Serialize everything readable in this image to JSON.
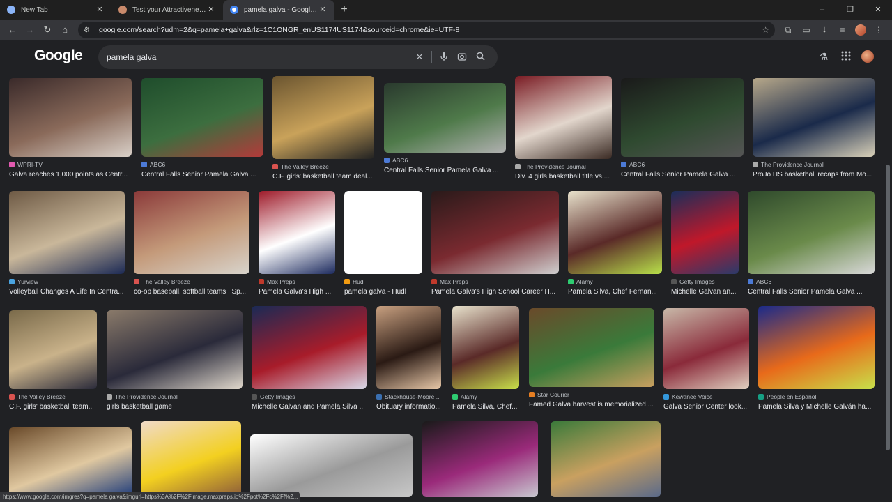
{
  "tabs": [
    {
      "title": "New Tab",
      "active": false,
      "favicon_color": "#8ab4f8"
    },
    {
      "title": "Test your Attractiveness with AI",
      "active": false,
      "favicon_color": "#c98a6b"
    },
    {
      "title": "pamela galva - Google Search",
      "active": true,
      "favicon_color": "#4285f4"
    }
  ],
  "window": {
    "minimize": "–",
    "restore": "❐",
    "close": "✕",
    "new_tab": "+"
  },
  "toolbar": {
    "url": "google.com/search?udm=2&q=pamela+galva&rlz=1C1ONGR_enUS1174US1174&sourceid=chrome&ie=UTF-8",
    "back": "←",
    "forward": "→",
    "reload": "↻",
    "home": "⌂",
    "tune": "⚙",
    "star": "☆",
    "ext": "⧉",
    "cast": "▭",
    "download": "⤓",
    "menu": "⋮"
  },
  "google": {
    "logo": "Google",
    "query": "pamela galva",
    "icons": {
      "clear": "✕",
      "voice": "🎤",
      "lens": "⌾",
      "search": "⌕",
      "labs": "⚗",
      "apps": "⋮⋮"
    }
  },
  "results": [
    {
      "source": "WPRI-TV",
      "caption": "Galva reaches 1,000 points as Centr...",
      "fav": "#e15ab0",
      "colors": [
        "#3a2a2a",
        "#8a6a5a",
        "#d9d0c8"
      ]
    },
    {
      "source": "ABC6",
      "caption": "Central Falls Senior Pamela Galva ...",
      "fav": "#4c7ad6",
      "colors": [
        "#1f4d2c",
        "#3c6e3f",
        "#b33a3a"
      ]
    },
    {
      "source": "The Valley Breeze",
      "caption": "C.F. girls' basketball team deal...",
      "fav": "#d9534f",
      "colors": [
        "#6b5530",
        "#c9a25a",
        "#222"
      ]
    },
    {
      "source": "ABC6",
      "caption": "Central Falls Senior Pamela Galva ...",
      "fav": "#4c7ad6",
      "colors": [
        "#2a3a2e",
        "#4f7a4a",
        "#b0b0b0"
      ]
    },
    {
      "source": "The Providence Journal",
      "caption": "Div. 4 girls basketball title vs....",
      "fav": "#aaaaaa",
      "colors": [
        "#7a1c24",
        "#e2d6cc",
        "#3b2b24"
      ]
    },
    {
      "source": "ABC6",
      "caption": "Central Falls Senior Pamela Galva ...",
      "fav": "#4c7ad6",
      "colors": [
        "#1a1a1a",
        "#2f4a30",
        "#555"
      ]
    },
    {
      "source": "The Providence Journal",
      "caption": "ProJo HS basketball recaps from Mo...",
      "fav": "#aaaaaa",
      "colors": [
        "#b7a88a",
        "#1a2a4a",
        "#d8d0b8"
      ]
    },
    {
      "source": "Yurview",
      "caption": "Volleyball Changes A Life In Centra...",
      "fav": "#4aa3df",
      "colors": [
        "#6e5a45",
        "#c9b79a",
        "#1c2a55"
      ]
    },
    {
      "source": "The Valley Breeze",
      "caption": "co-op baseball, softball teams | Sp...",
      "fav": "#d9534f",
      "colors": [
        "#8b3a3a",
        "#c49a7a",
        "#d8d4cc"
      ]
    },
    {
      "source": "Max Preps",
      "caption": "Pamela Galva's High ...",
      "fav": "#c0392b",
      "colors": [
        "#9e1b2a",
        "#ffffff",
        "#1c2a5e"
      ]
    },
    {
      "source": "Hudl",
      "caption": "pamela galva - Hudl",
      "fav": "#f39c12",
      "colors": [
        "#ffffff",
        "#ffffff",
        "#ffffff"
      ]
    },
    {
      "source": "Max Preps",
      "caption": "Pamela Galva's High School Career H...",
      "fav": "#c0392b",
      "colors": [
        "#2a1a1a",
        "#7a2a30",
        "#cfcfcf"
      ]
    },
    {
      "source": "Alamy",
      "caption": "Pamela Silva, Chef Fernan...",
      "fav": "#2ecc71",
      "colors": [
        "#e8e2cc",
        "#5a2a28",
        "#b8e04a"
      ]
    },
    {
      "source": "Getty Images",
      "caption": "Michelle Galvan an...",
      "fav": "#555555",
      "colors": [
        "#1a2e5a",
        "#c0182a",
        "#2a3a6a"
      ]
    },
    {
      "source": "ABC6",
      "caption": "Central Falls Senior Pamela Galva ...",
      "fav": "#4c7ad6",
      "colors": [
        "#2f4a2c",
        "#6a8a4a",
        "#d8d8d8"
      ]
    },
    {
      "source": "The Valley Breeze",
      "caption": "C.F. girls' basketball team...",
      "fav": "#d9534f",
      "colors": [
        "#7a6a4a",
        "#c9b28a",
        "#2a2a3a"
      ]
    },
    {
      "source": "The Providence Journal",
      "caption": "girls basketball game",
      "fav": "#aaaaaa",
      "colors": [
        "#8a7a6a",
        "#2a2a3a",
        "#e0d8cc"
      ]
    },
    {
      "source": "Getty Images",
      "caption": "Michelle Galvan and Pamela Silva ...",
      "fav": "#555555",
      "colors": [
        "#1a2a55",
        "#a81c2a",
        "#d8d8e8"
      ]
    },
    {
      "source": "Stackhouse-Moore ...",
      "caption": "Obituary informatio...",
      "fav": "#3a6fb0",
      "colors": [
        "#c8a080",
        "#2a1a14",
        "#e8c8a8"
      ]
    },
    {
      "source": "Alamy",
      "caption": "Pamela Silva, Chef...",
      "fav": "#2ecc71",
      "colors": [
        "#e8e2cc",
        "#5a2a28",
        "#c8e04a"
      ]
    },
    {
      "source": "Star Courier",
      "caption": "Famed Galva harvest is memorialized ...",
      "fav": "#e67e22",
      "colors": [
        "#6a4a2a",
        "#3a7a3a",
        "#c9a060"
      ]
    },
    {
      "source": "Kewanee Voice",
      "caption": "Galva Senior Center look...",
      "fav": "#3498db",
      "colors": [
        "#c8b8a8",
        "#8a2a3a",
        "#e0d0c0"
      ]
    },
    {
      "source": "People en Español",
      "caption": "Pamela Silva y Michelle Galván ha...",
      "fav": "#16a085",
      "colors": [
        "#1a2a8a",
        "#e86a1a",
        "#c8e04a"
      ]
    },
    {
      "source": "",
      "caption": "",
      "fav": "#000000",
      "colors": [
        "#6a4a2a",
        "#e0c8a0",
        "#1c3a7a"
      ]
    },
    {
      "source": "",
      "caption": "",
      "fav": "#000000",
      "colors": [
        "#f0dac8",
        "#f3d020",
        "#8a5a3a"
      ]
    },
    {
      "source": "",
      "caption": "",
      "fav": "#000000",
      "colors": [
        "#ffffff",
        "#9a9a9a",
        "#c8c8c8"
      ]
    },
    {
      "source": "",
      "caption": "",
      "fav": "#000000",
      "colors": [
        "#1a1a1a",
        "#9a2a7a",
        "#c8c8d0"
      ]
    },
    {
      "source": "",
      "caption": "",
      "fav": "#000000",
      "colors": [
        "#3a7a3a",
        "#c9a060",
        "#5a6a8a"
      ]
    }
  ],
  "statusbar": {
    "url": "https://www.google.com/imgres?q=pamela galva&imgurl=https%3A%2F%2Fimage.maxpreps.io%2Fpot%2Fc%2Ff%2..."
  }
}
